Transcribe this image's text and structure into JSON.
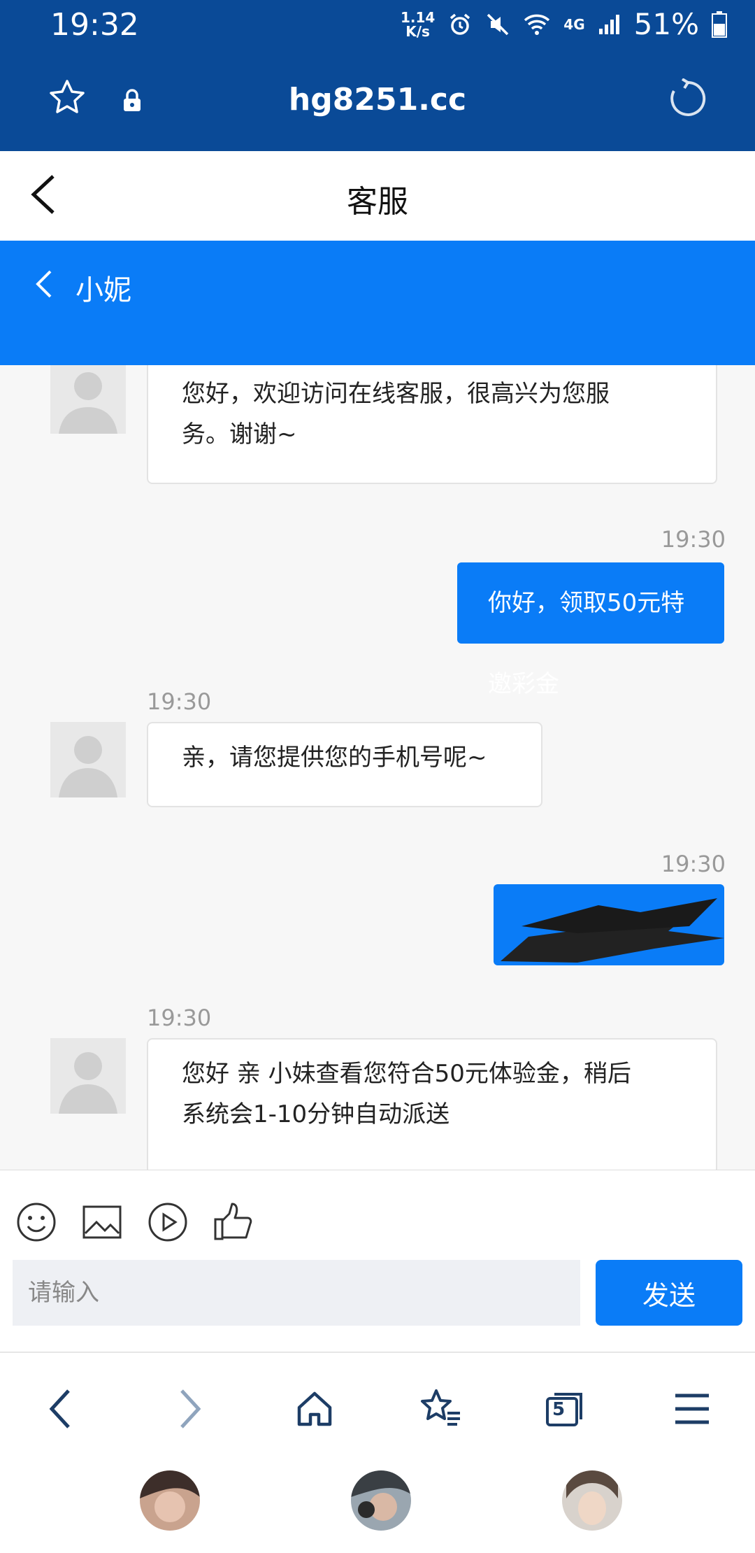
{
  "status": {
    "time": "19:32",
    "speed_top": "1.14",
    "speed_bottom": "K/s",
    "net": "4G",
    "battery": "51%"
  },
  "browser": {
    "url": "hg8251.cc"
  },
  "page": {
    "title": "客服"
  },
  "chat": {
    "agent_name": "小妮",
    "messages": [
      {
        "text_line1": "您好，欢迎访问在线客服，很高兴为您服",
        "text_line2": "务。谢谢~"
      },
      {
        "time": "19:30",
        "text": "你好，领取50元特邀彩金"
      },
      {
        "time": "19:30",
        "text": "亲，请您提供您的手机号呢~"
      },
      {
        "time": "19:30"
      },
      {
        "time": "19:30",
        "text_line1": "您好 亲 小妹查看您符合50元体验金，稍后",
        "text_line2": "系统会1-10分钟自动派送"
      }
    ]
  },
  "composer": {
    "placeholder": "请输入",
    "send_label": "发送"
  },
  "browser_nav": {
    "tabs_count": "5"
  },
  "colors": {
    "header": "#0a4a97",
    "accent": "#0a7cf7"
  },
  "icons": [
    "star-icon",
    "lock-icon",
    "reload-icon",
    "back-icon",
    "emoji-icon",
    "image-icon",
    "video-icon",
    "like-icon",
    "home-icon",
    "bookmarks-icon",
    "tabs-icon",
    "menu-icon"
  ]
}
